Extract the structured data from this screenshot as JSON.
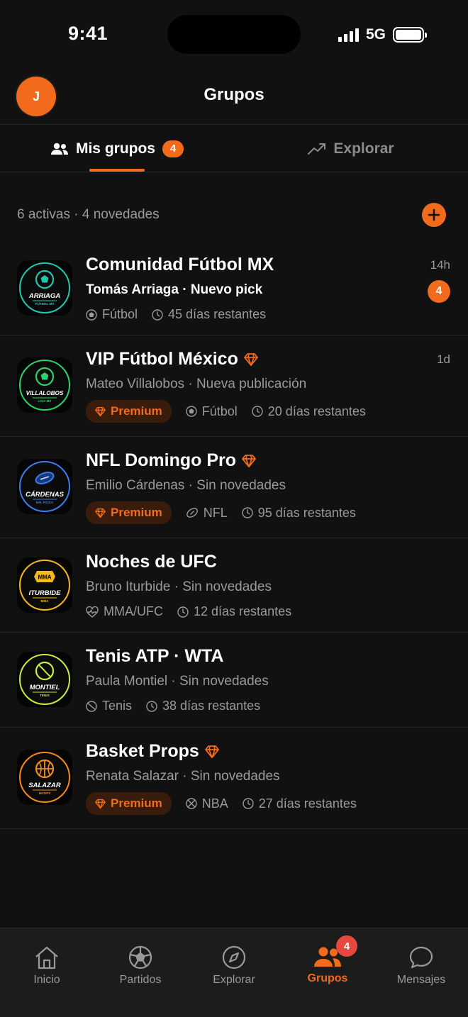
{
  "status_bar": {
    "time": "9:41",
    "network": "5G"
  },
  "header": {
    "avatar_initial": "J",
    "title": "Grupos"
  },
  "tabs": [
    {
      "label": "Mis grupos",
      "badge": "4",
      "active": true,
      "icon": "users-icon"
    },
    {
      "label": "Explorar",
      "active": false,
      "icon": "trending-up-icon"
    }
  ],
  "summary": {
    "text": "6 activas · 4 novedades"
  },
  "groups": [
    {
      "name": "Comunidad Fútbol MX",
      "logo_text": "ARRIAGA",
      "logo_sub": "FÚTBOL MX",
      "logo_color": "#1ec9b0",
      "logo_icon": "soccer-ball-icon",
      "subtitle": "Tomás Arriaga · Nuevo pick",
      "subtitle_highlight": true,
      "premium": false,
      "premium_label": "",
      "sport": "Fútbol",
      "sport_icon": "soccer-ball-icon",
      "days": "45 días restantes",
      "time": "14h",
      "unread": "4"
    },
    {
      "name": "VIP Fútbol México",
      "logo_text": "VILLALOBOS",
      "logo_sub": "LIGA MX",
      "logo_color": "#2bd36a",
      "logo_icon": "soccer-ball-icon",
      "subtitle": "Mateo Villalobos · Nueva publicación",
      "subtitle_highlight": false,
      "premium": true,
      "premium_label": "Premium",
      "sport": "Fútbol",
      "sport_icon": "soccer-ball-icon",
      "days": "20 días restantes",
      "time": "1d",
      "unread": ""
    },
    {
      "name": "NFL Domingo Pro",
      "logo_text": "CÁRDENAS",
      "logo_sub": "NFL PICKS",
      "logo_color": "#3b7df0",
      "logo_icon": "football-icon",
      "subtitle": "Emilio Cárdenas · Sin novedades",
      "subtitle_highlight": false,
      "premium": true,
      "premium_label": "Premium",
      "sport": "NFL",
      "sport_icon": "football-icon",
      "days": "95 días restantes",
      "time": "",
      "unread": ""
    },
    {
      "name": "Noches de UFC",
      "logo_text": "ITURBIDE",
      "logo_sub": "MMA",
      "logo_color": "#f5b81c",
      "logo_icon": "mma-badge-icon",
      "subtitle": "Bruno Iturbide · Sin novedades",
      "subtitle_highlight": false,
      "premium": false,
      "premium_label": "",
      "sport": "MMA/UFC",
      "sport_icon": "heart-pulse-icon",
      "days": "12 días restantes",
      "time": "",
      "unread": ""
    },
    {
      "name": "Tenis ATP · WTA",
      "logo_text": "MONTIEL",
      "logo_sub": "TENIS",
      "logo_color": "#c8ee3c",
      "logo_icon": "tennis-ball-icon",
      "subtitle": "Paula Montiel · Sin novedades",
      "subtitle_highlight": false,
      "premium": false,
      "premium_label": "",
      "sport": "Tenis",
      "sport_icon": "tennis-ball-icon",
      "days": "38 días restantes",
      "time": "",
      "unread": ""
    },
    {
      "name": "Basket Props",
      "logo_text": "SALAZAR",
      "logo_sub": "HOOPS",
      "logo_color": "#f28a1d",
      "logo_icon": "basketball-icon",
      "subtitle": "Renata Salazar · Sin novedades",
      "subtitle_highlight": false,
      "premium": true,
      "premium_label": "Premium",
      "sport": "NBA",
      "sport_icon": "basketball-icon",
      "days": "27 días restantes",
      "time": "",
      "unread": ""
    }
  ],
  "bottom_nav": [
    {
      "label": "Inicio",
      "icon": "home-icon",
      "active": false,
      "badge": ""
    },
    {
      "label": "Partidos",
      "icon": "soccer-ball-icon",
      "active": false,
      "badge": ""
    },
    {
      "label": "Explorar",
      "icon": "compass-icon",
      "active": false,
      "badge": ""
    },
    {
      "label": "Grupos",
      "icon": "users-icon",
      "active": true,
      "badge": "4"
    },
    {
      "label": "Mensajes",
      "icon": "chat-bubble-icon",
      "active": false,
      "badge": ""
    }
  ],
  "colors": {
    "accent": "#f26b1d",
    "background": "#111111",
    "muted": "#9a9a9a",
    "badge_red": "#e5483c"
  }
}
